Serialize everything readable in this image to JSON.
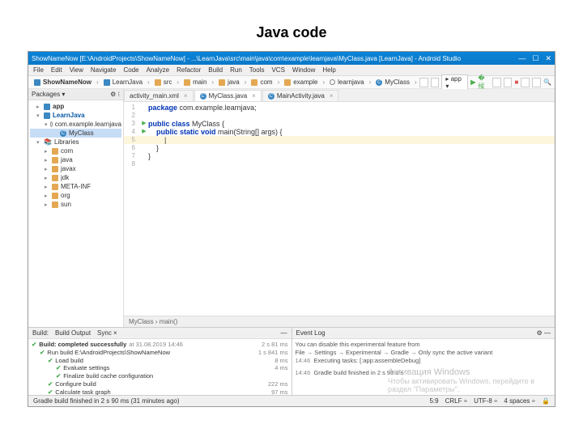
{
  "slide": {
    "title": "Java code"
  },
  "window": {
    "title": "ShowNameNow [E:\\AndroidProjects\\ShowNameNow] - ...\\LearnJava\\src\\main\\java\\com\\example\\learnjava\\MyClass.java [LearnJava] - Android Studio"
  },
  "menu": [
    "File",
    "Edit",
    "View",
    "Navigate",
    "Code",
    "Analyze",
    "Refactor",
    "Build",
    "Run",
    "Tools",
    "VCS",
    "Window",
    "Help"
  ],
  "breadcrumbs": [
    "ShowNameNow",
    "LearnJava",
    "src",
    "main",
    "java",
    "com",
    "example",
    "learnjava",
    "MyClass"
  ],
  "toolbar": {
    "runConfig": "app"
  },
  "sidebar": {
    "header": "Packages ▾",
    "items": [
      "app",
      "LearnJava",
      "com.example.learnjava",
      "MyClass",
      "Libraries",
      "com",
      "java",
      "javax",
      "jdk",
      "META-INF",
      "org",
      "sun"
    ]
  },
  "editor": {
    "tabs": [
      "activity_main.xml",
      "MyClass.java",
      "MainActivity.java"
    ],
    "code": {
      "pkg": "com.example.learnjava",
      "className": "MyClass"
    },
    "structCrumb": "MyClass  ›  main()"
  },
  "build": {
    "tabs": [
      "Build:",
      "Build Output",
      "Sync  ×"
    ],
    "root": {
      "label": "Build: completed successfully",
      "time": "at 31.08.2019 14:46",
      "dur": "2 s 81 ms"
    },
    "items": [
      {
        "label": "Run build E:\\AndroidProjects\\ShowNameNow",
        "dur": "1 s 841 ms"
      },
      {
        "label": "Load build",
        "dur": "8 ms"
      },
      {
        "label": "Evaluate settings",
        "dur": "4 ms"
      },
      {
        "label": "Finalize build cache configuration",
        "dur": ""
      },
      {
        "label": "Configure build",
        "dur": "222 ms"
      },
      {
        "label": "Calculate task graph",
        "dur": "97 ms"
      }
    ]
  },
  "eventLog": {
    "title": "Event Log",
    "lines": [
      "You can disable this experimental feature from",
      "File → Settings → Experimental → Gradle → Only sync the active variant",
      {
        "t": "14:46",
        "m": "Executing tasks: [:app:assembleDebug]"
      },
      {
        "t": "14:46",
        "m": "Gradle build finished in 2 s 90 ms"
      }
    ]
  },
  "status": {
    "left": "Gradle build finished in 2 s 90 ms (31 minutes ago)",
    "caret": "5:9",
    "lineend": "CRLF ÷",
    "encoding": "UTF-8 ÷",
    "indent": "4 spaces ÷",
    "lock": "🔒"
  },
  "watermark": {
    "line1": "Активация Windows",
    "line2": "Чтобы активировать Windows, перейдите в",
    "line3": "раздел \"Параметры\"."
  }
}
